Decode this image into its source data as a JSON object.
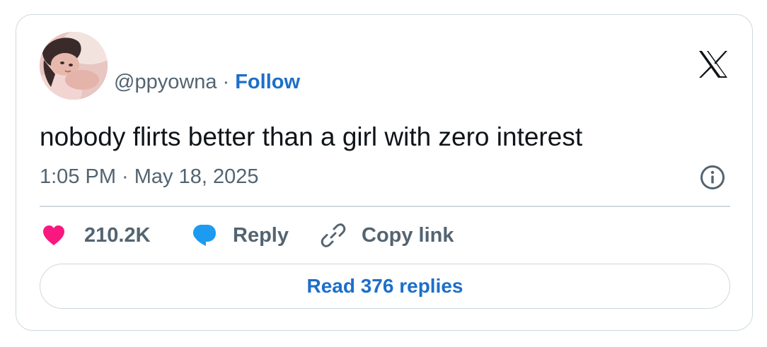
{
  "tweet": {
    "handle": "@ppyowna",
    "separator": "·",
    "follow_label": "Follow",
    "text": "nobody flirts better than a girl with zero interest",
    "timestamp": "1:05 PM · May 18, 2025"
  },
  "actions": {
    "like_count": "210.2K",
    "reply_label": "Reply",
    "copy_link_label": "Copy link"
  },
  "footer": {
    "read_replies_label": "Read 376 replies"
  },
  "icons": {
    "brand": "x-logo-icon",
    "info": "info-icon",
    "like": "heart-icon",
    "reply": "speech-bubble-icon",
    "copy": "link-icon"
  },
  "colors": {
    "follow": "#1d6fc9",
    "heart": "#f91880",
    "reply_bubble": "#1d9bf0",
    "muted_text": "#536471",
    "border": "#cfd9de"
  }
}
